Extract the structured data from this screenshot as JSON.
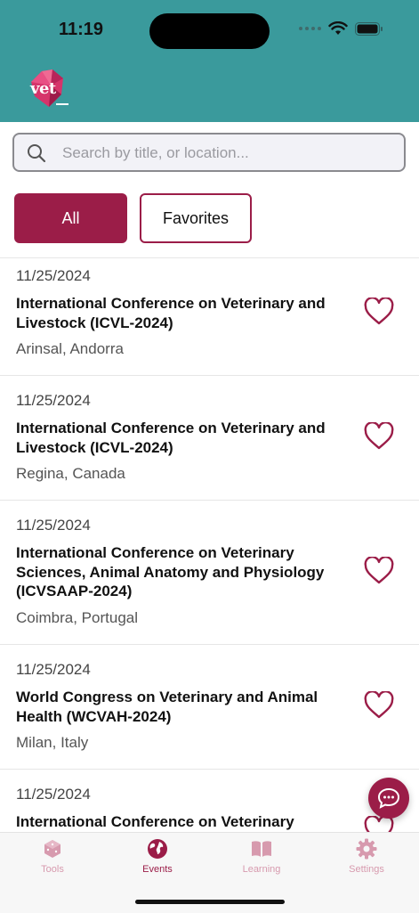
{
  "status_bar": {
    "time": "11:19"
  },
  "app": {
    "logo_text": "vet"
  },
  "search": {
    "placeholder": "Search by title, or location...",
    "value": ""
  },
  "filters": {
    "all_label": "All",
    "favorites_label": "Favorites",
    "selected": "All"
  },
  "events": [
    {
      "date": "11/25/2024",
      "title": "International Conference on Veterinary and Livestock (ICVL-2024)",
      "location": "Arinsal, Andorra",
      "favorite": false
    },
    {
      "date": "11/25/2024",
      "title": "International Conference on Veterinary and Livestock (ICVL-2024)",
      "location": "Regina, Canada",
      "favorite": false
    },
    {
      "date": "11/25/2024",
      "title": "International Conference on Veterinary Sciences, Animal Anatomy and Physiology (ICVSAAP-2024)",
      "location": "Coimbra, Portugal",
      "favorite": false
    },
    {
      "date": "11/25/2024",
      "title": "World Congress on Veterinary and Animal Health (WCVAH-2024)",
      "location": "Milan, Italy",
      "favorite": false
    },
    {
      "date": "11/25/2024",
      "title": "International Conference on Veterinary",
      "location": "",
      "favorite": false
    }
  ],
  "tabbar": {
    "items": [
      {
        "label": "Tools",
        "icon": "dice-icon",
        "active": false
      },
      {
        "label": "Events",
        "icon": "globe-icon",
        "active": true
      },
      {
        "label": "Learning",
        "icon": "book-icon",
        "active": false
      },
      {
        "label": "Settings",
        "icon": "gear-icon",
        "active": false
      }
    ]
  },
  "colors": {
    "header": "#3a9a9c",
    "accent": "#9b1d48",
    "inactive_tab": "#d79aae"
  }
}
